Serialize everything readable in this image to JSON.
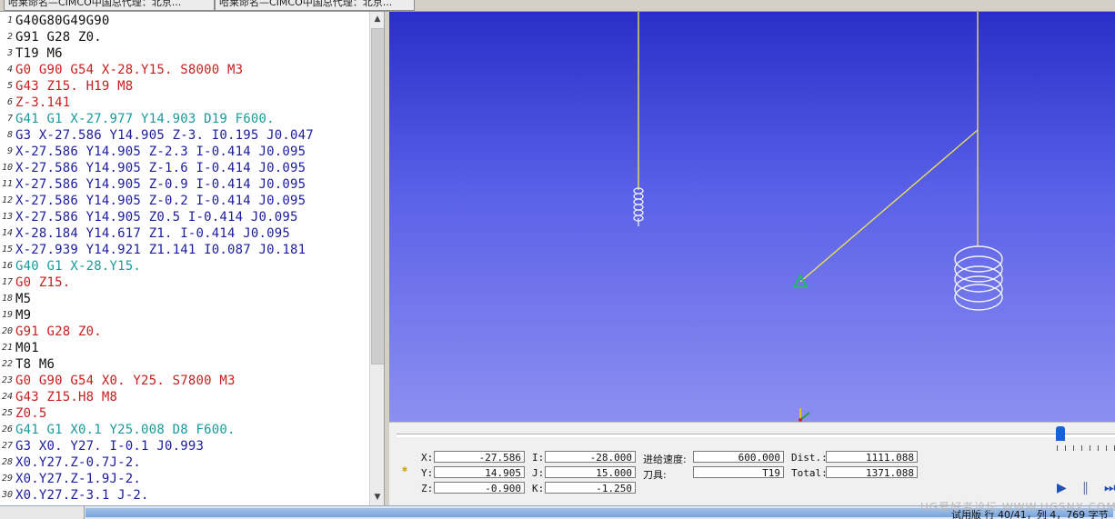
{
  "tabs": [
    {
      "label": "哈莱命名—CIMCO中国总代理：北京..."
    },
    {
      "label": "哈莱命名—CIMCO中国总代理：北京..."
    }
  ],
  "editor": {
    "lines": [
      {
        "num": "1",
        "text": "G40G80G49G90",
        "color": "black"
      },
      {
        "num": "2",
        "text": "G91 G28 Z0.",
        "color": "black"
      },
      {
        "num": "3",
        "text": "T19 M6",
        "color": "black"
      },
      {
        "num": "4",
        "text": "G0 G90 G54 X-28.Y15. S8000 M3",
        "color": "red"
      },
      {
        "num": "5",
        "text": "G43 Z15. H19 M8",
        "color": "red"
      },
      {
        "num": "6",
        "text": "Z-3.141",
        "color": "red"
      },
      {
        "num": "7",
        "text": "G41 G1 X-27.977 Y14.903 D19 F600.",
        "color": "teal"
      },
      {
        "num": "8",
        "text": "G3 X-27.586 Y14.905 Z-3. I0.195 J0.047",
        "color": "navy"
      },
      {
        "num": "9",
        "text": "X-27.586 Y14.905 Z-2.3 I-0.414 J0.095",
        "color": "navy"
      },
      {
        "num": "10",
        "text": "X-27.586 Y14.905 Z-1.6 I-0.414 J0.095",
        "color": "navy"
      },
      {
        "num": "11",
        "text": "X-27.586 Y14.905 Z-0.9 I-0.414 J0.095",
        "color": "navy"
      },
      {
        "num": "12",
        "text": "X-27.586 Y14.905 Z-0.2 I-0.414 J0.095",
        "color": "navy"
      },
      {
        "num": "13",
        "text": "X-27.586 Y14.905 Z0.5 I-0.414 J0.095",
        "color": "navy"
      },
      {
        "num": "14",
        "text": "X-28.184 Y14.617 Z1. I-0.414 J0.095",
        "color": "navy"
      },
      {
        "num": "15",
        "text": "X-27.939 Y14.921 Z1.141 I0.087 J0.181",
        "color": "navy"
      },
      {
        "num": "16",
        "text": "G40 G1 X-28.Y15.",
        "color": "teal"
      },
      {
        "num": "17",
        "text": "G0 Z15.",
        "color": "red"
      },
      {
        "num": "18",
        "text": "M5",
        "color": "black"
      },
      {
        "num": "19",
        "text": "M9",
        "color": "black"
      },
      {
        "num": "20",
        "text": "G91 G28 Z0.",
        "color": "red"
      },
      {
        "num": "21",
        "text": "M01",
        "color": "black"
      },
      {
        "num": "22",
        "text": "T8 M6",
        "color": "black"
      },
      {
        "num": "23",
        "text": "G0 G90 G54 X0. Y25. S7800 M3",
        "color": "red"
      },
      {
        "num": "24",
        "text": "G43 Z15.H8 M8",
        "color": "red"
      },
      {
        "num": "25",
        "text": "Z0.5",
        "color": "red"
      },
      {
        "num": "26",
        "text": "G41 G1 X0.1 Y25.008 D8 F600.",
        "color": "teal"
      },
      {
        "num": "27",
        "text": "G3 X0. Y27. I-0.1 J0.993",
        "color": "navy"
      },
      {
        "num": "28",
        "text": "X0.Y27.Z-0.7J-2.",
        "color": "navy"
      },
      {
        "num": "29",
        "text": "X0.Y27.Z-1.9J-2.",
        "color": "navy"
      },
      {
        "num": "30",
        "text": "X0.Y27.Z-3.1 J-2.",
        "color": "navy"
      }
    ]
  },
  "readout": {
    "x_label": "X:",
    "x_value": "-27.586",
    "y_label": "Y:",
    "y_value": "14.905",
    "z_label": "Z:",
    "z_value": "-0.900",
    "i_label": "I:",
    "i_value": "-28.000",
    "j_label": "J:",
    "j_value": "15.000",
    "k_label": "K:",
    "k_value": "-1.250",
    "feed_label": "进给速度:",
    "feed_value": "600.000",
    "tool_label": "刀具:",
    "tool_value": "T19",
    "dist_label": "Dist.:",
    "dist_value": "1111.088",
    "total_label": "Total:",
    "total_value": "1371.088"
  },
  "status": {
    "text": "试用版   行 40/41，列 4，769 字节",
    "watermark": "UG爱好者论坛 WWW.UGSNX.COM"
  },
  "colors": {
    "viewport_top": "#2a2ec8",
    "viewport_bottom": "#8c8ff0",
    "toolpath": "#e6e05a",
    "tool_marker": "#22bb66",
    "helix": "#f2f2f2"
  }
}
